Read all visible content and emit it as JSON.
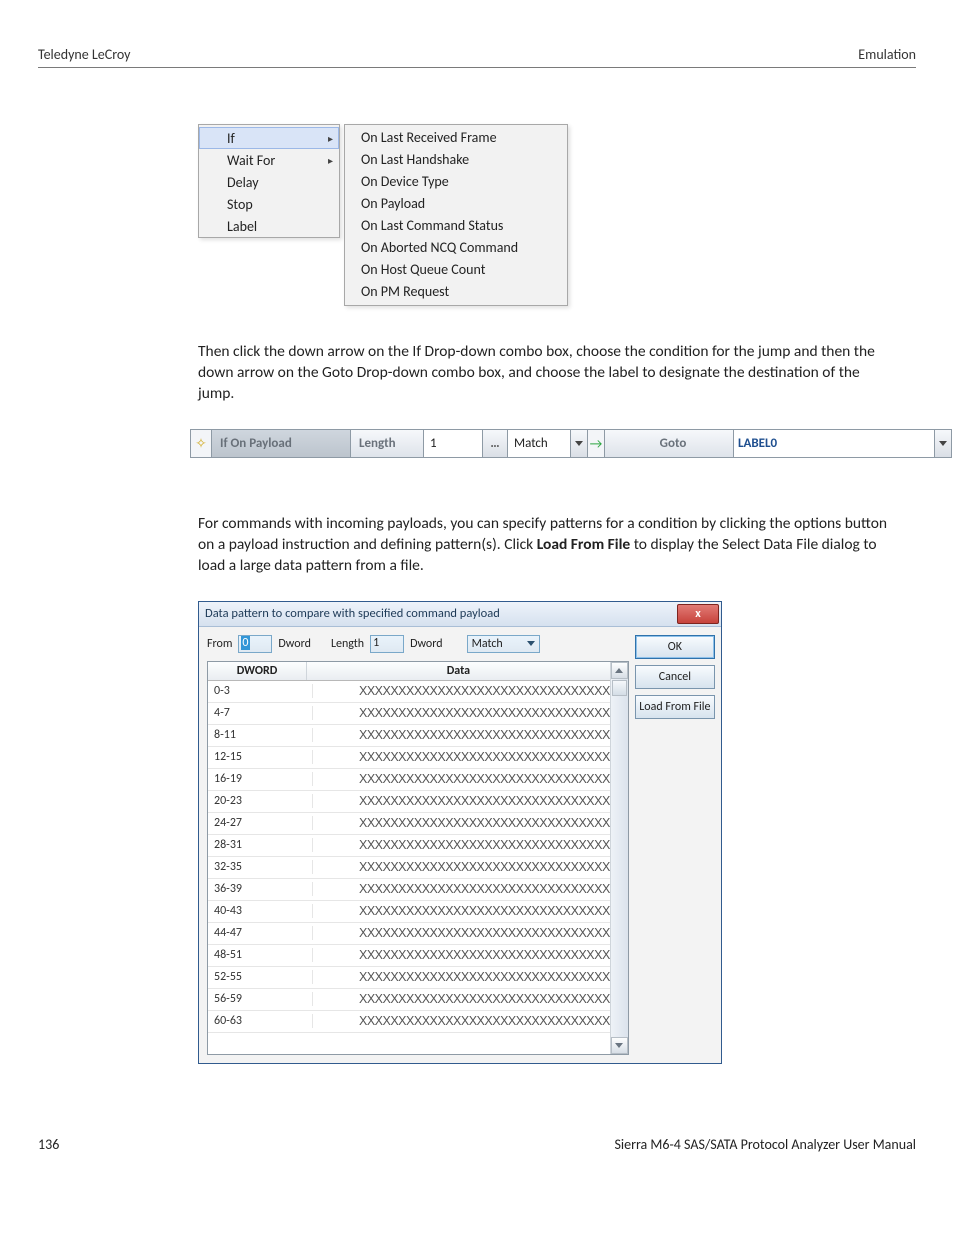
{
  "header": {
    "left": "Teledyne LeCroy",
    "right": "Emulation"
  },
  "menu_left": [
    {
      "label": "If",
      "arrow": true,
      "selected": true
    },
    {
      "label": "Wait For",
      "arrow": true
    },
    {
      "label": "Delay"
    },
    {
      "label": "Stop"
    },
    {
      "label": "Label"
    }
  ],
  "menu_right": [
    "On Last Received Frame",
    "On Last Handshake",
    "On Device Type",
    "On Payload",
    "On Last Command Status",
    "On Aborted NCQ Command",
    "On Host Queue Count",
    "On PM Request"
  ],
  "para1": "Then click the down arrow on the If Drop-down combo box, choose the condition for the jump and then the down arrow on the Goto Drop-down combo box, and choose the label to designate the destination of the jump.",
  "ifbar": {
    "icon": "✧",
    "title": "If On Payload",
    "length_label": "Length",
    "length_value": "1",
    "options_btn": "…",
    "match_label": "Match",
    "arrow": "→",
    "goto_label": "Goto",
    "target": "LABEL0"
  },
  "para2a": "For commands with incoming payloads, you can specify patterns for a condition by clicking the options button on a payload instruction and defining pattern(s). Click ",
  "para2b": "Load From File",
  "para2c": " to display the Select Data File dialog to load a large data pattern from a file.",
  "dialog": {
    "title": "Data pattern to compare with specified command payload",
    "close": "x",
    "from_label": "From",
    "from_value": "0",
    "dword1": "Dword",
    "length_label": "Length",
    "length_value": "1",
    "dword2": "Dword",
    "match_label": "Match",
    "col_dword": "DWORD",
    "col_data": "Data",
    "data_x": "XXXXXXXXXXXXXXXXXXXXXXXXXXXXXXXX",
    "rows": [
      "0-3",
      "4-7",
      "8-11",
      "12-15",
      "16-19",
      "20-23",
      "24-27",
      "28-31",
      "32-35",
      "36-39",
      "40-43",
      "44-47",
      "48-51",
      "52-55",
      "56-59",
      "60-63"
    ],
    "ok": "OK",
    "cancel": "Cancel",
    "load": "Load From File"
  },
  "footer": {
    "page": "136",
    "title": "Sierra M6-4 SAS/SATA Protocol Analyzer User Manual"
  }
}
